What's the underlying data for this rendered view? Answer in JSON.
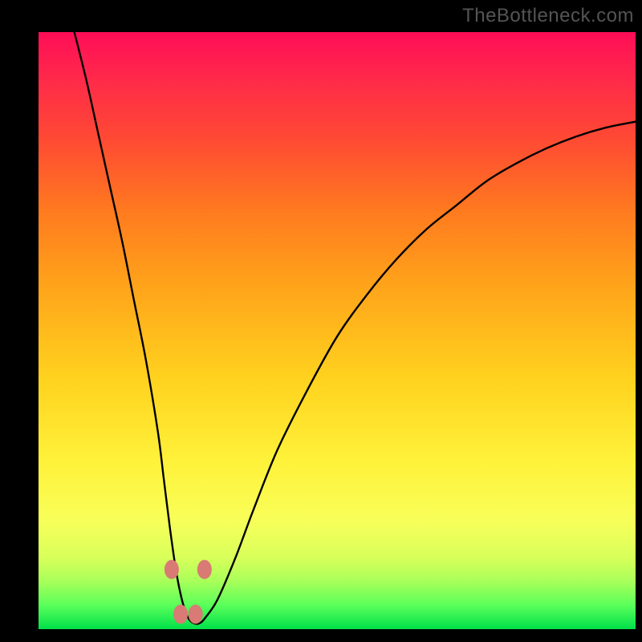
{
  "watermark": "TheBottleneck.com",
  "colors": {
    "page_bg": "#000000",
    "gradient_top": "#ff0d57",
    "gradient_bottom": "#00e04a",
    "curve": "#000000",
    "markers": "#d97a74"
  },
  "chart_data": {
    "type": "line",
    "title": "",
    "xlabel": "",
    "ylabel": "",
    "xlim": [
      0,
      100
    ],
    "ylim": [
      0,
      100
    ],
    "grid": false,
    "annotations": [],
    "series": [
      {
        "name": "bottleneck-curve",
        "x": [
          6,
          8,
          10,
          12,
          14,
          16,
          18,
          20,
          21,
          22,
          23,
          24,
          25,
          26,
          27,
          28,
          30,
          33,
          36,
          40,
          45,
          50,
          55,
          60,
          65,
          70,
          75,
          80,
          85,
          90,
          95,
          100
        ],
        "y": [
          100,
          92,
          83,
          74,
          65,
          55,
          45,
          33,
          25,
          17,
          10,
          5,
          2,
          1,
          1,
          2,
          5,
          12,
          20,
          30,
          40,
          49,
          56,
          62,
          67,
          71,
          75,
          78,
          80.5,
          82.5,
          84,
          85
        ]
      }
    ],
    "markers": [
      {
        "x": 22.3,
        "y": 10
      },
      {
        "x": 27.8,
        "y": 10
      },
      {
        "x": 23.8,
        "y": 2.5
      },
      {
        "x": 26.3,
        "y": 2.5
      }
    ]
  }
}
